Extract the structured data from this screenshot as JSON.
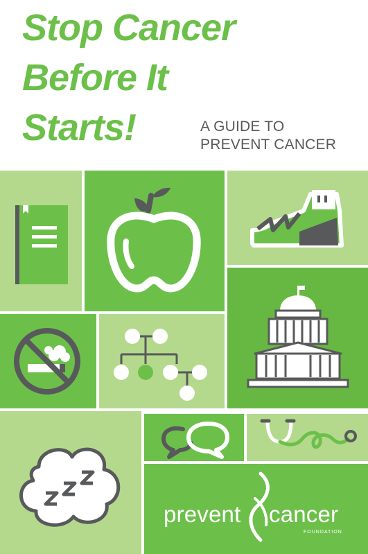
{
  "cover": {
    "title_lines": [
      "Stop Cancer",
      "Before It",
      "Starts!"
    ],
    "subtitle_lines": [
      "A GUIDE TO",
      "PREVENT CANCER"
    ]
  },
  "logo": {
    "word_left": "prevent",
    "word_right": "cancer",
    "tagline": "FOUNDATION"
  },
  "tiles": [
    {
      "icon": "notebook-icon"
    },
    {
      "icon": "apple-icon"
    },
    {
      "icon": "sneaker-icon"
    },
    {
      "icon": "capitol-building-icon"
    },
    {
      "icon": "no-smoking-icon"
    },
    {
      "icon": "family-tree-icon"
    },
    {
      "icon": "sleep-zzz-icon"
    },
    {
      "icon": "speech-bubbles-icon"
    },
    {
      "icon": "stethoscope-icon"
    }
  ],
  "colors": {
    "brand_green": "#6cc04a",
    "light_green": "#b4d98d",
    "dark_gray": "#58595b",
    "white": "#ffffff"
  }
}
